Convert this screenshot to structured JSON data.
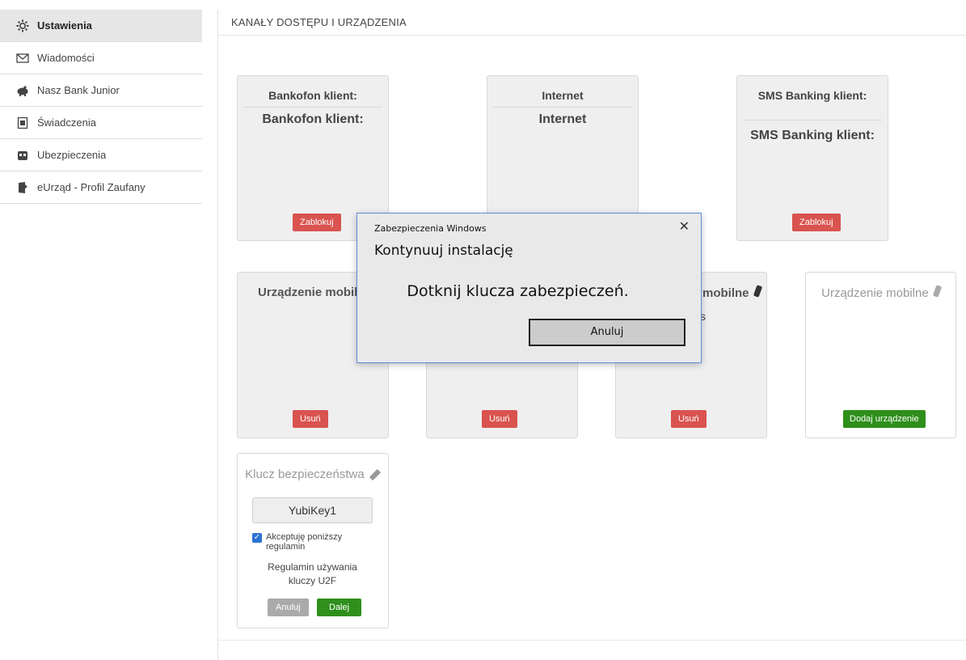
{
  "sidebar": {
    "items": [
      {
        "label": "Ustawienia",
        "icon": "gear-icon"
      },
      {
        "label": "Wiadomości",
        "icon": "envelope-icon"
      },
      {
        "label": "Nasz Bank Junior",
        "icon": "piggy-bank-icon"
      },
      {
        "label": "Świadczenia",
        "icon": "document-icon"
      },
      {
        "label": "Ubezpieczenia",
        "icon": "insurance-icon"
      },
      {
        "label": "eUrząd - Profil Zaufany",
        "icon": "door-icon"
      }
    ]
  },
  "header": {
    "title": "KANAŁY DOSTĘPU I URZĄDZENIA"
  },
  "channels": [
    {
      "title": "Bankofon klient:",
      "subtitle": "Bankofon klient:",
      "button": "Zablokuj"
    },
    {
      "title": "Internet",
      "subtitle": "Internet",
      "button": ""
    },
    {
      "title": "SMS Banking klient:",
      "subtitle": "SMS Banking klient:",
      "button": "Zablokuj"
    }
  ],
  "devices": [
    {
      "title": "Urządzenie mobilne",
      "button": "Usuń"
    },
    {
      "title": "",
      "button": "Usuń"
    },
    {
      "title": "mobilne",
      "extra": "s",
      "button": "Usuń"
    },
    {
      "title": "Urządzenie mobilne",
      "button": "Dodaj urządzenie"
    }
  ],
  "security_key": {
    "title": "Klucz bezpieczeństwa",
    "key_name": "YubiKey1",
    "checkbox_label": "Akceptuję poniższy regulamin",
    "checked": true,
    "regulamin": "Regulamin używania kluczy U2F",
    "cancel": "Anuluj",
    "next": "Dalej"
  },
  "dialog": {
    "caption": "Zabezpieczenia Windows",
    "heading": "Kontynuuj instalację",
    "message": "Dotknij klucza zabezpieczeń.",
    "button": "Anuluj",
    "close": "✕"
  },
  "colors": {
    "danger": "#d9534f",
    "success": "#2f8f1b",
    "dialog_border": "#5a8dd6"
  }
}
